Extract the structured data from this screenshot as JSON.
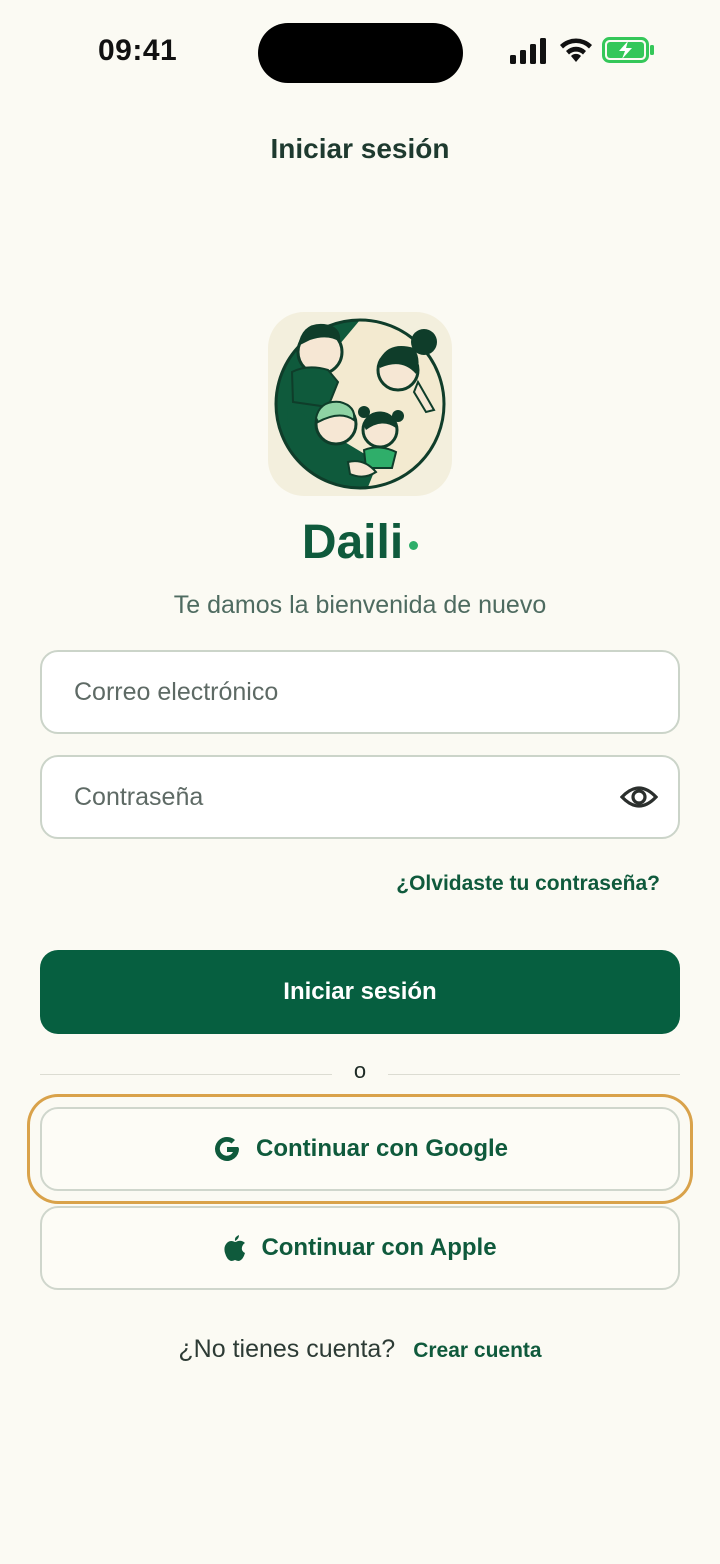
{
  "status_bar": {
    "time": "09:41"
  },
  "header": {
    "title": "Iniciar sesión"
  },
  "brand": {
    "name": "Daili",
    "tagline": "Te damos la bienvenida de nuevo"
  },
  "form": {
    "email_placeholder": "Correo electrónico",
    "email_value": "",
    "password_placeholder": "Contraseña",
    "password_value": "",
    "forgot_label": "¿Olvidaste tu contraseña?",
    "submit_label": "Iniciar sesión"
  },
  "divider": {
    "label": "o"
  },
  "social": {
    "google_label": "Continuar con Google",
    "apple_label": "Continuar con Apple"
  },
  "footer": {
    "prompt": "¿No tienes cuenta?",
    "link_label": "Crear cuenta"
  },
  "colors": {
    "background": "#fbfaf3",
    "primary": "#065f40",
    "accent_dot": "#2fae6a",
    "focus_ring": "#d9a24a",
    "battery": "#34c759"
  },
  "icons": [
    "signal-icon",
    "wifi-icon",
    "battery-icon",
    "eye-icon",
    "google-icon",
    "apple-icon",
    "family-logo"
  ]
}
